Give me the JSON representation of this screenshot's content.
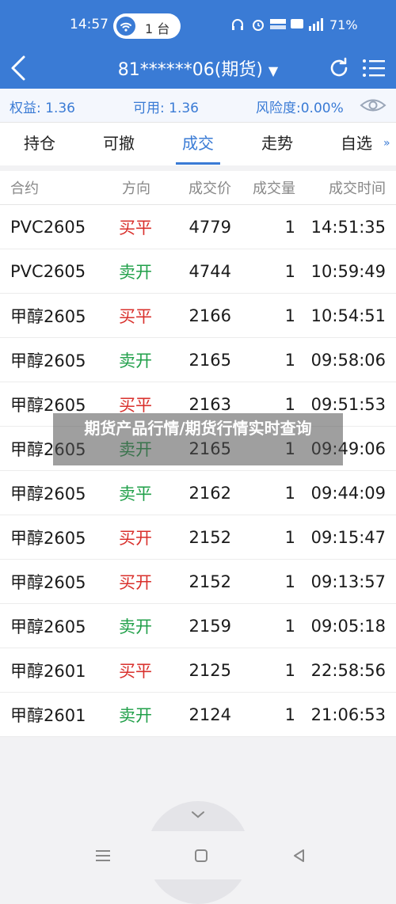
{
  "status_bar": {
    "time": "14:57",
    "pill_text": "1 台",
    "battery": "71%"
  },
  "header": {
    "title": "81******06(期货)"
  },
  "account": {
    "equity": "权益: 1.36",
    "available": "可用: 1.36",
    "risk": "风险度:0.00%"
  },
  "tabs": [
    {
      "label": "持仓"
    },
    {
      "label": "可撤"
    },
    {
      "label": "成交"
    },
    {
      "label": "走势"
    },
    {
      "label": "自选"
    }
  ],
  "table": {
    "headers": {
      "contract": "合约",
      "direction": "方向",
      "price": "成交价",
      "volume": "成交量",
      "time": "成交时间"
    },
    "rows": [
      {
        "contract": "PVC2605",
        "direction": "买平",
        "price": "4779",
        "volume": "1",
        "time": "14:51:35"
      },
      {
        "contract": "PVC2605",
        "direction": "卖开",
        "price": "4744",
        "volume": "1",
        "time": "10:59:49"
      },
      {
        "contract": "甲醇2605",
        "direction": "买平",
        "price": "2166",
        "volume": "1",
        "time": "10:54:51"
      },
      {
        "contract": "甲醇2605",
        "direction": "卖开",
        "price": "2165",
        "volume": "1",
        "time": "09:58:06"
      },
      {
        "contract": "甲醇2605",
        "direction": "买平",
        "price": "2163",
        "volume": "1",
        "time": "09:51:53"
      },
      {
        "contract": "甲醇2605",
        "direction": "卖开",
        "price": "2165",
        "volume": "1",
        "time": "09:49:06"
      },
      {
        "contract": "甲醇2605",
        "direction": "卖平",
        "price": "2162",
        "volume": "1",
        "time": "09:44:09"
      },
      {
        "contract": "甲醇2605",
        "direction": "买开",
        "price": "2152",
        "volume": "1",
        "time": "09:15:47"
      },
      {
        "contract": "甲醇2605",
        "direction": "买开",
        "price": "2152",
        "volume": "1",
        "time": "09:13:57"
      },
      {
        "contract": "甲醇2605",
        "direction": "卖开",
        "price": "2159",
        "volume": "1",
        "time": "09:05:18"
      },
      {
        "contract": "甲醇2601",
        "direction": "买平",
        "price": "2125",
        "volume": "1",
        "time": "22:58:56"
      },
      {
        "contract": "甲醇2601",
        "direction": "卖开",
        "price": "2124",
        "volume": "1",
        "time": "21:06:53"
      }
    ]
  },
  "overlay": {
    "text": "期货产品行情/期货行情实时查询"
  },
  "colors": {
    "accent": "#3a7bd5",
    "buy": "#d9302c",
    "sell": "#21a04a"
  },
  "icons": [
    "back-icon",
    "dropdown-icon",
    "refresh-icon",
    "menu-icon",
    "eye-icon",
    "chevron-down-icon",
    "wifi-icon",
    "headphone-icon",
    "alarm-icon",
    "signal-icon",
    "battery-icon",
    "nav-menu-icon",
    "nav-home-icon",
    "nav-back-icon"
  ]
}
